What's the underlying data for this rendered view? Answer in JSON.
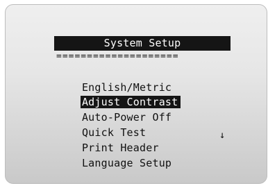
{
  "screen": {
    "title": "System Setup",
    "separator": "====================",
    "menu": [
      {
        "label": "English/Metric",
        "selected": false
      },
      {
        "label": "Adjust Contrast",
        "selected": true
      },
      {
        "label": "Auto-Power Off",
        "selected": false
      },
      {
        "label": "Quick Test",
        "selected": false
      },
      {
        "label": "Print Header",
        "selected": false
      },
      {
        "label": "Language Setup",
        "selected": false
      }
    ],
    "scroll_indicator": "↓"
  }
}
